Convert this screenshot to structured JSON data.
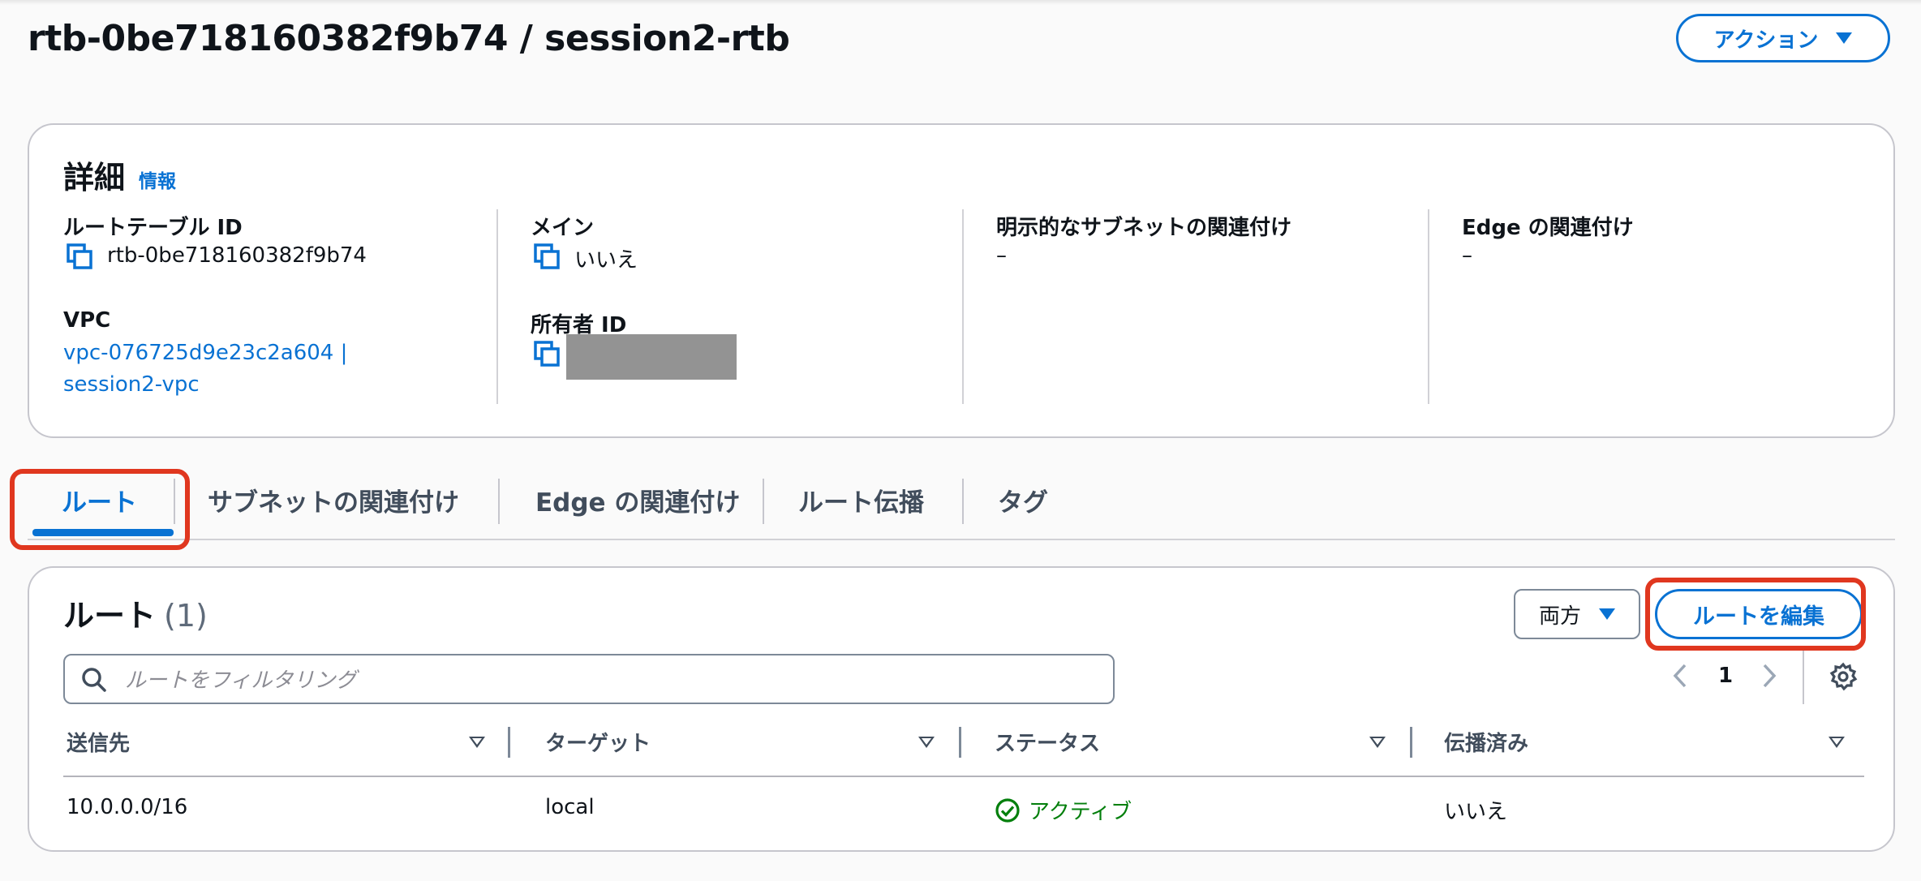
{
  "header": {
    "title": "rtb-0be718160382f9b74 / session2-rtb",
    "actions_label": "アクション"
  },
  "details": {
    "title": "詳細",
    "info_link": "情報",
    "route_table_id_label": "ルートテーブル ID",
    "route_table_id": "rtb-0be718160382f9b74",
    "vpc_label": "VPC",
    "vpc_value": "vpc-076725d9e23c2a604 | session2-vpc",
    "main_label": "メイン",
    "main_value": "いいえ",
    "owner_id_label": "所有者 ID",
    "explicit_subnet_label": "明示的なサブネットの関連付け",
    "explicit_subnet_value": "–",
    "edge_label": "Edge の関連付け",
    "edge_value": "–"
  },
  "tabs": [
    {
      "label": "ルート"
    },
    {
      "label": "サブネットの関連付け"
    },
    {
      "label": "Edge の関連付け"
    },
    {
      "label": "ルート伝播"
    },
    {
      "label": "タグ"
    }
  ],
  "routes": {
    "title": "ルート",
    "count": "(1)",
    "filter_select": "両方",
    "edit_button": "ルートを編集",
    "search_placeholder": "ルートをフィルタリング",
    "page": "1",
    "columns": [
      "送信先",
      "ターゲット",
      "ステータス",
      "伝播済み"
    ],
    "rows": [
      {
        "destination": "10.0.0.0/16",
        "target": "local",
        "status": "アクティブ",
        "propagated": "いいえ"
      }
    ]
  },
  "colors": {
    "accent": "#0972d3",
    "highlight": "#e0371f",
    "success": "#037f0c"
  }
}
